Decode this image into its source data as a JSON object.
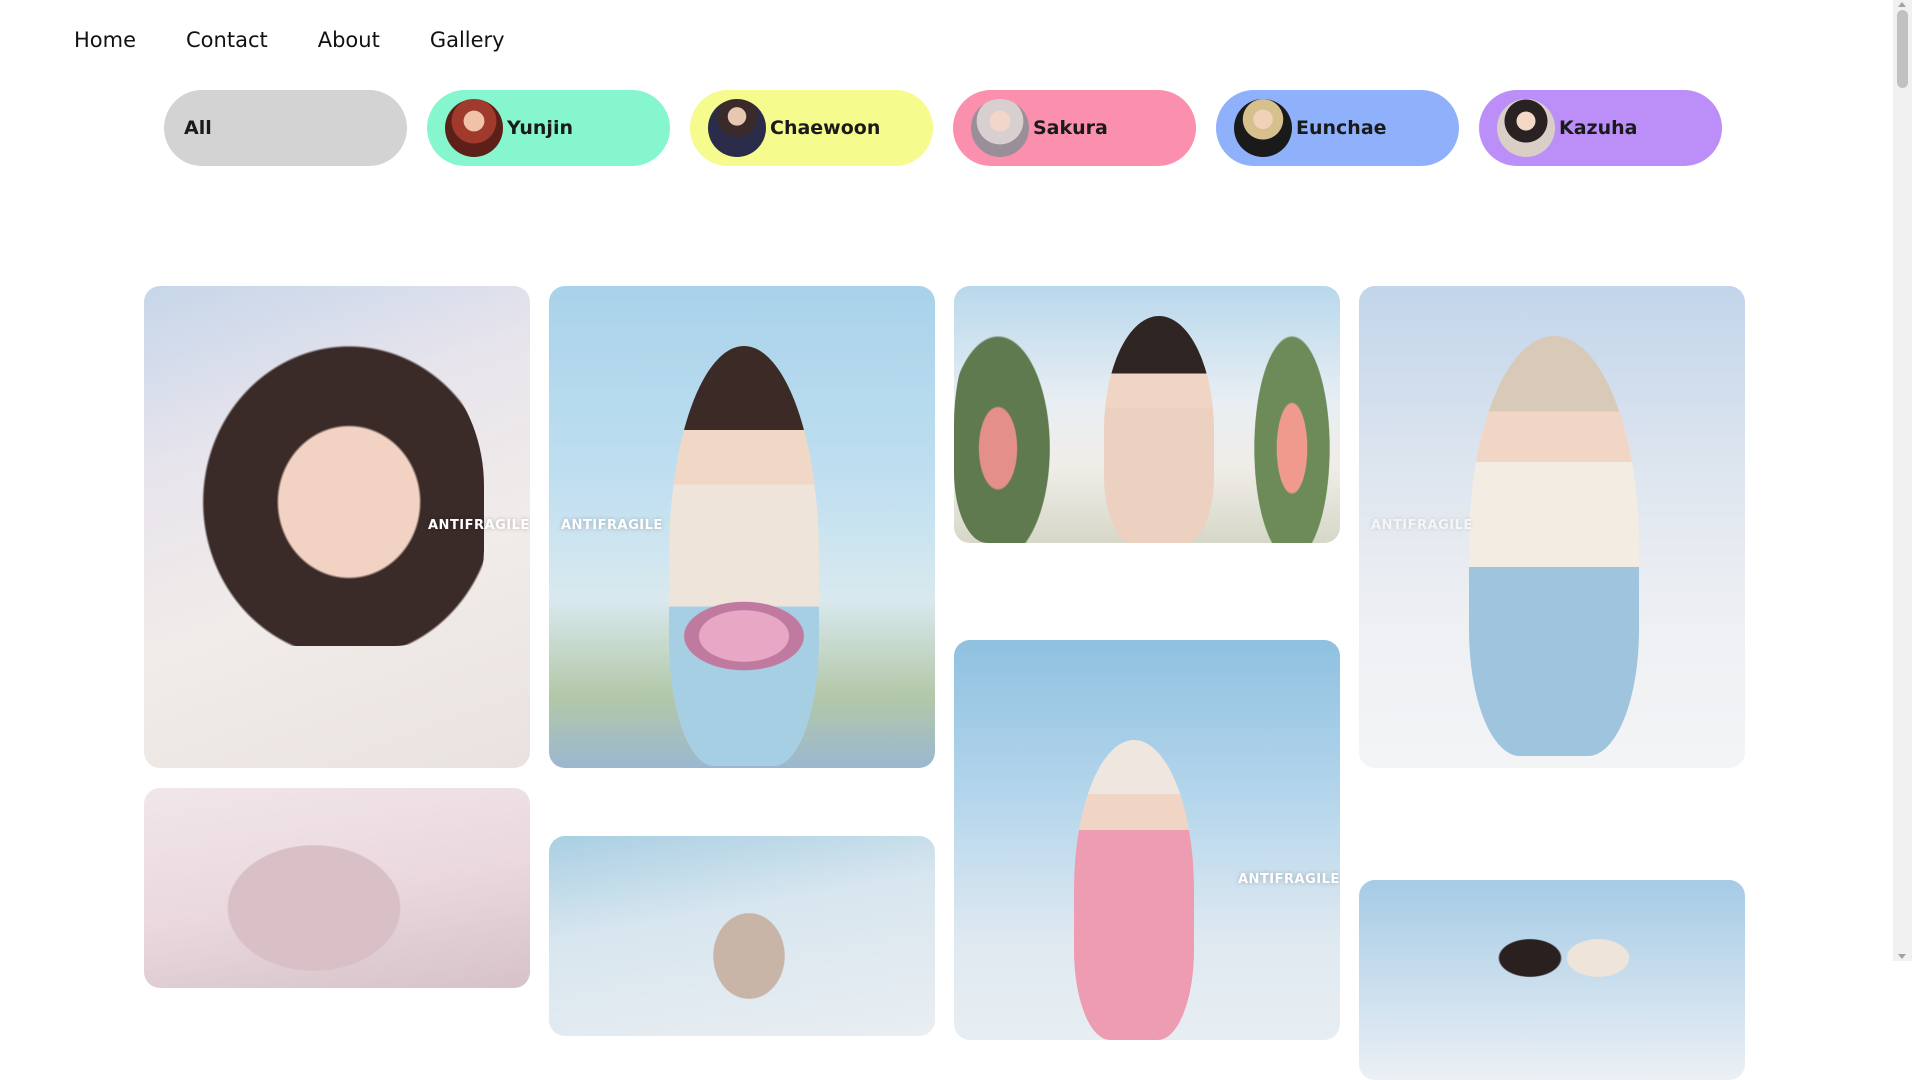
{
  "nav": {
    "home": "Home",
    "contact": "Contact",
    "about": "About",
    "gallery": "Gallery"
  },
  "filters": [
    {
      "label": "All",
      "color": "#d3d3d3"
    },
    {
      "label": "Yunjin",
      "color": "#86f6cf"
    },
    {
      "label": "Chaewoon",
      "color": "#f5fb8c"
    },
    {
      "label": "Sakura",
      "color": "#fb8fae"
    },
    {
      "label": "Eunchae",
      "color": "#8fb0fa"
    },
    {
      "label": "Kazuha",
      "color": "#bb8ff7"
    }
  ],
  "gallery": {
    "watermark": "ANTIFRAGILE"
  }
}
